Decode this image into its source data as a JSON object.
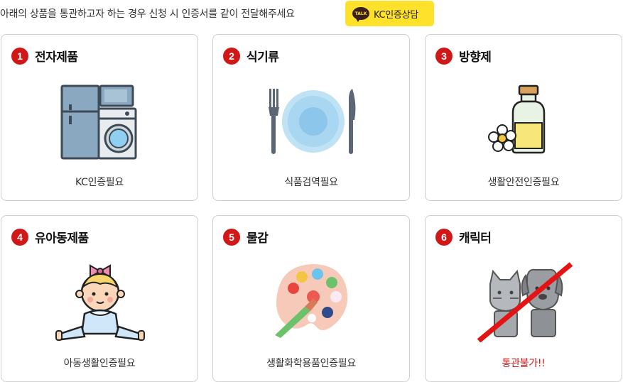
{
  "notice": {
    "text": "아래의 상품을 통관하고자 하는 경우 신청 시 인증서를 같이 전달해주세요",
    "kakao_badge": "TALK",
    "kakao_label": "KC인증상담"
  },
  "cards": [
    {
      "num": "1",
      "title": "전자제품",
      "caption": "KC인증필요",
      "icon": "appliances-icon"
    },
    {
      "num": "2",
      "title": "식기류",
      "caption": "식품검역필요",
      "icon": "tableware-icon"
    },
    {
      "num": "3",
      "title": "방향제",
      "caption": "생활안전인증필요",
      "icon": "air-freshener-icon"
    },
    {
      "num": "4",
      "title": "유아동제품",
      "caption": "아동생활인증필요",
      "icon": "baby-icon"
    },
    {
      "num": "5",
      "title": "물감",
      "caption": "생활화학용품인증필요",
      "icon": "paint-palette-icon"
    },
    {
      "num": "6",
      "title": "캐릭터",
      "caption": "통관불가!!",
      "icon": "character-figures-icon"
    }
  ],
  "colors": {
    "accent": "#d01818",
    "kakao": "#fde12b",
    "border": "#cfcfcf"
  }
}
